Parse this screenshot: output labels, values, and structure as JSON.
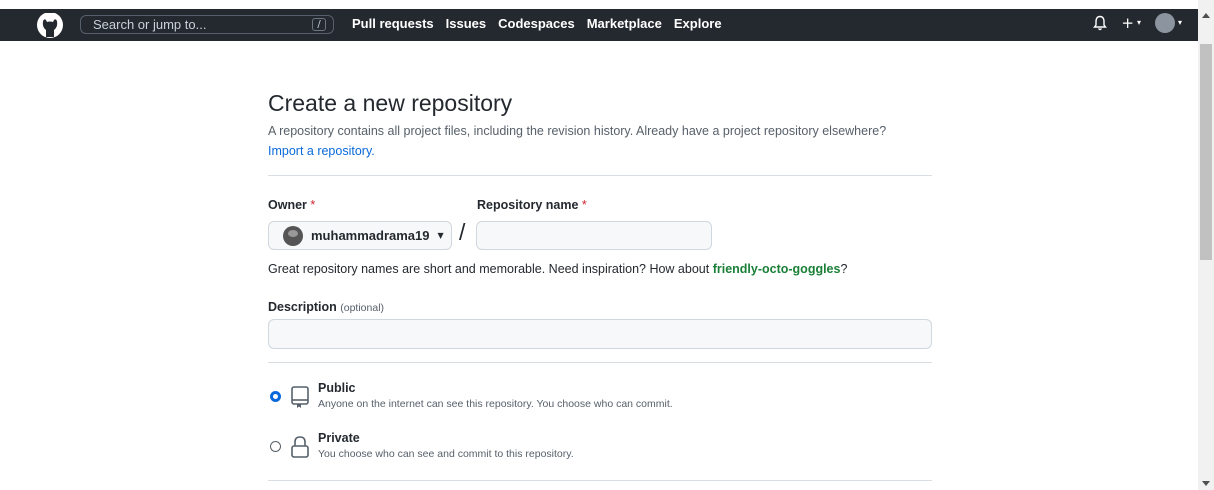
{
  "header": {
    "search_placeholder": "Search or jump to...",
    "search_shortcut": "/",
    "nav": [
      "Pull requests",
      "Issues",
      "Codespaces",
      "Marketplace",
      "Explore"
    ]
  },
  "page": {
    "title": "Create a new repository",
    "subtitle": "A repository contains all project files, including the revision history. Already have a project repository elsewhere?",
    "import_link": "Import a repository."
  },
  "form": {
    "owner_label": "Owner",
    "repo_label": "Repository name",
    "required_mark": "*",
    "owner_value": "muhammadrama19",
    "slash": "/",
    "repo_value": "",
    "suggestion_prefix": "Great repository names are short and memorable. Need inspiration? How about",
    "suggestion_name": "friendly-octo-goggles",
    "suggestion_suffix": "?",
    "description_label": "Description",
    "description_optional": "(optional)",
    "description_value": ""
  },
  "visibility": [
    {
      "title": "Public",
      "description": "Anyone on the internet can see this repository. You choose who can commit.",
      "checked": true,
      "icon": "repo-icon"
    },
    {
      "title": "Private",
      "description": "You choose who can see and commit to this repository.",
      "checked": false,
      "icon": "lock-icon"
    }
  ],
  "colors": {
    "header_bg": "#24292f",
    "link": "#0969da",
    "suggestion": "#1a7f37",
    "required": "#cf222e"
  }
}
